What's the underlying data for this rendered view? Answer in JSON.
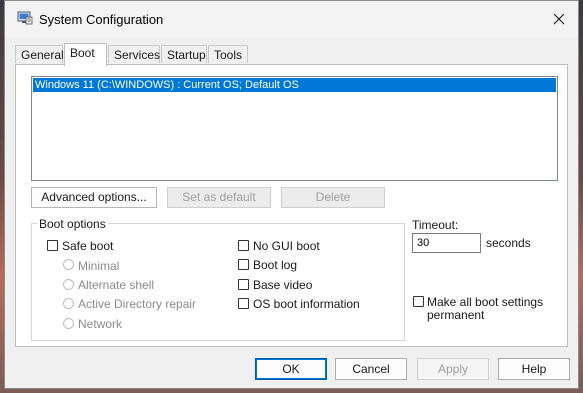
{
  "window": {
    "title": "System Configuration"
  },
  "tabs": [
    {
      "label": "General"
    },
    {
      "label": "Boot"
    },
    {
      "label": "Services"
    },
    {
      "label": "Startup"
    },
    {
      "label": "Tools"
    }
  ],
  "boot": {
    "os_entries": [
      "Windows 11 (C:\\WINDOWS) : Current OS; Default OS"
    ],
    "advanced_label": "Advanced options...",
    "set_default_label": "Set as default",
    "delete_label": "Delete",
    "options_title": "Boot options",
    "safe_boot": "Safe boot",
    "minimal": "Minimal",
    "alternate_shell": "Alternate shell",
    "ad_repair": "Active Directory repair",
    "network": "Network",
    "no_gui": "No GUI boot",
    "boot_log": "Boot log",
    "base_video": "Base video",
    "os_info": "OS boot information",
    "timeout_label": "Timeout:",
    "timeout_value": "30",
    "seconds_label": "seconds",
    "permanent_line1": "Make all boot settings",
    "permanent_line2": "permanent"
  },
  "buttons": {
    "ok": "OK",
    "cancel": "Cancel",
    "apply": "Apply",
    "help": "Help"
  },
  "icons": {
    "app": "msconfig-icon",
    "close": "close-icon"
  },
  "colors": {
    "selection": "#0078d7",
    "window_bg": "#f0f0f0",
    "panel_bg": "#ffffff"
  }
}
